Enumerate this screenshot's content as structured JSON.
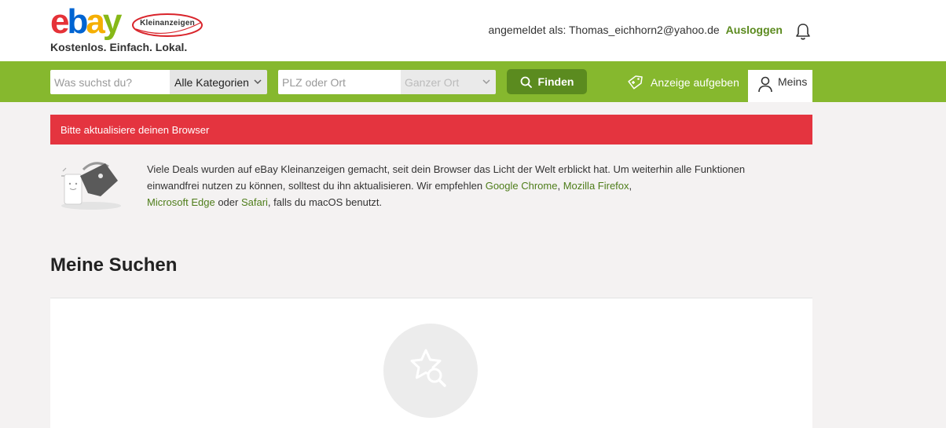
{
  "header": {
    "logo": {
      "letters": [
        "e",
        "b",
        "a",
        "y"
      ],
      "letter_colors": [
        "#e53238",
        "#0064d2",
        "#f5af02",
        "#86b817"
      ],
      "seal_text": "Kleinanzeigen"
    },
    "slogan": "Kostenlos. Einfach. Lokal.",
    "user": {
      "logged_in_label": "angemeldet als: Thomas_eichhorn2@yahoo.de",
      "logout": "Ausloggen"
    },
    "bell_icon": "bell-icon"
  },
  "search": {
    "query_placeholder": "Was suchst du?",
    "category": "Alle Kategorien",
    "location_placeholder": "PLZ oder Ort",
    "radius": "Ganzer Ort",
    "find": "Finden"
  },
  "nav": {
    "post_ad": "Anzeige aufgeben",
    "meins": "Meins"
  },
  "alert": {
    "text": "Bitte aktualisiere deinen Browser"
  },
  "notice": {
    "t1": "Viele Deals wurden auf eBay Kleinanzeigen gemacht, seit dein Browser das Licht der Welt erblickt hat. Um weiterhin alle Funktionen einwandfrei nutzen zu können, solltest du ihn aktualisieren. Wir empfehlen ",
    "chrome": "Google Chrome",
    "sep1": ", ",
    "firefox": "Mozilla Firefox",
    "sep2": ", ",
    "edge": "Microsoft Edge",
    "t2": " oder ",
    "safari": "Safari",
    "t3": ", falls du macOS benutzt."
  },
  "main": {
    "title": "Meine Suchen",
    "empty_icon": "star-search-icon"
  },
  "colors": {
    "header_green": "#86b82e",
    "button_green": "#5b8b1f",
    "link_green": "#4e7d1a",
    "alert_red": "#e4343f"
  }
}
